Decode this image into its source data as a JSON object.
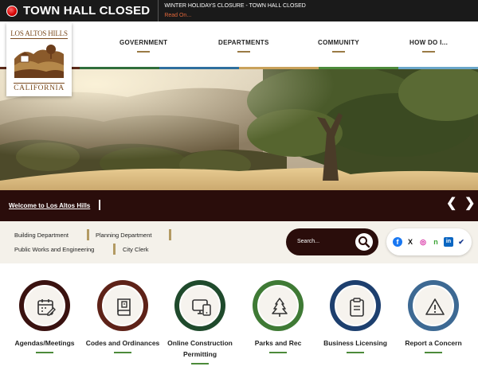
{
  "alert": {
    "title": "TOWN HALL CLOSED",
    "message": "WINTER HOLIDAYS CLOSURE - TOWN HALL CLOSED",
    "link": "Read On..."
  },
  "logo": {
    "top_text": "LOS ALTOS HILLS",
    "bottom_text": "CALIFORNIA"
  },
  "nav": {
    "items": [
      {
        "label": "GOVERNMENT"
      },
      {
        "label": "DEPARTMENTS"
      },
      {
        "label": "COMMUNITY"
      },
      {
        "label": "HOW DO I..."
      }
    ]
  },
  "colors": {
    "stripe": [
      "#5b2a1a",
      "#2f6e3b",
      "#2e6f9e",
      "#c9a15a",
      "#4c8a3a",
      "#6aa6c9"
    ],
    "maroon": "#2a0d0b",
    "accent_gold": "#9a7b45",
    "accent_green": "#4c8a3a"
  },
  "hero": {
    "caption": "Welcome to Los Altos Hills",
    "prev_icon": "chevron-left-icon",
    "next_icon": "chevron-right-icon"
  },
  "quick_links": [
    {
      "label": "Building Department"
    },
    {
      "label": "Planning Department"
    },
    {
      "label": "Public Works and Engineering"
    },
    {
      "label": "City Clerk"
    }
  ],
  "search": {
    "placeholder": "Search...",
    "icon": "search-icon"
  },
  "social": [
    {
      "name": "facebook-icon",
      "glyph": "f",
      "color": "#1877f2"
    },
    {
      "name": "x-icon",
      "glyph": "X",
      "color": "#111111"
    },
    {
      "name": "instagram-icon",
      "glyph": "◎",
      "color": "#d6249f"
    },
    {
      "name": "nextdoor-icon",
      "glyph": "n",
      "color": "#3ba335"
    },
    {
      "name": "linkedin-icon",
      "glyph": "in",
      "color": "#0a66c2"
    },
    {
      "name": "checkmark-icon",
      "glyph": "✔",
      "color": "#1a3c8f"
    }
  ],
  "tiles": [
    {
      "label": "Agendas/Meetings",
      "color": "#3a1210",
      "icon": "calendar-edit-icon"
    },
    {
      "label": "Codes and Ordinances",
      "color": "#5e2218",
      "icon": "book-icon"
    },
    {
      "label": "Online Construction Permitting",
      "color": "#1f4a2c",
      "icon": "monitor-icon"
    },
    {
      "label": "Parks and Rec",
      "color": "#3f7a35",
      "icon": "tree-icon"
    },
    {
      "label": "Business Licensing",
      "color": "#1d3f6e",
      "icon": "clipboard-icon"
    },
    {
      "label": "Report a Concern",
      "color": "#3d6993",
      "icon": "warning-icon"
    }
  ]
}
